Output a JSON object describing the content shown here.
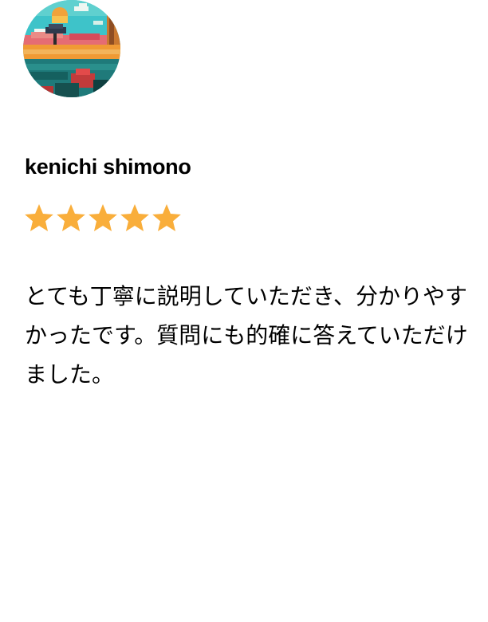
{
  "review": {
    "reviewer_name": "kenichi shimono",
    "rating": 5,
    "rating_max": 5,
    "star_color": "#F9AE3B",
    "text": "とても丁寧に説明していただき、分かりやすかったです。質問にも的確に答えていただけました。"
  },
  "avatar": {
    "icon": "pixel-art-landscape-avatar"
  }
}
